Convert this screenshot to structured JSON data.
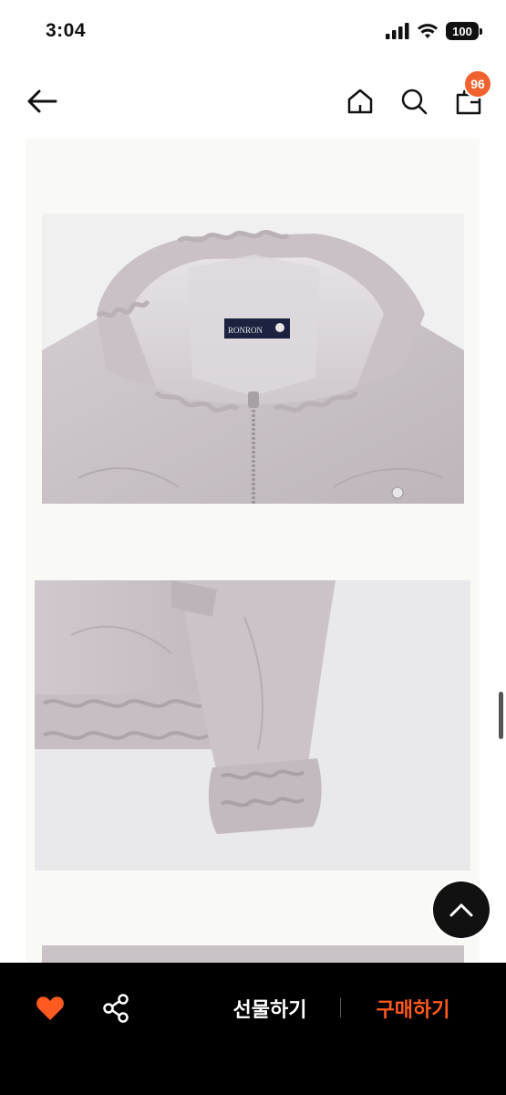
{
  "status_bar": {
    "time": "3:04",
    "battery_level": "100",
    "signal_bars": 4
  },
  "top_nav": {
    "cart_count": "96",
    "icons": [
      "arrow-left-icon",
      "home-icon",
      "search-icon",
      "shopping-bag-icon"
    ]
  },
  "product_images": {
    "label_brand": "RONRON",
    "images": [
      "jacket-hood-closeup",
      "jacket-sleeve-cuff-closeup",
      "jacket-detail-partial"
    ],
    "colors": {
      "fabric": "#c7c0c4",
      "background": "#f9f9f6"
    }
  },
  "bottom_bar": {
    "gift_label": "선물하기",
    "buy_label": "구매하기",
    "colors": {
      "like": "#ff5a1f",
      "buy": "#ff5a1f",
      "bar": "#000000"
    }
  }
}
